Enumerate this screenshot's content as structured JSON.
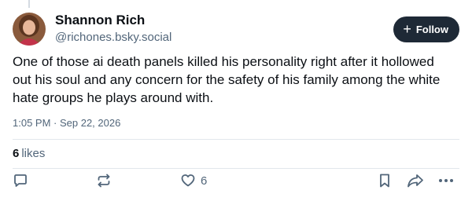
{
  "post": {
    "author_name": "Shannon Rich",
    "author_handle": "@richones.bsky.social",
    "follow_label": "Follow",
    "text": "One of those ai death panels killed his personality right after it hollowed out his soul and any concern for the safety of his family among the white hate groups he plays around with.",
    "timestamp": "1:05 PM · Sep 22, 2026",
    "likes_count": "6",
    "likes_word": "likes",
    "like_button_count": "6"
  },
  "colors": {
    "follow_bg": "#1e2936",
    "muted_text": "#52667a",
    "divider": "#e2e7ec"
  },
  "icons": [
    "follow-plus-icon",
    "reply-icon",
    "repost-icon",
    "heart-icon",
    "bookmark-icon",
    "share-icon",
    "more-icon"
  ]
}
